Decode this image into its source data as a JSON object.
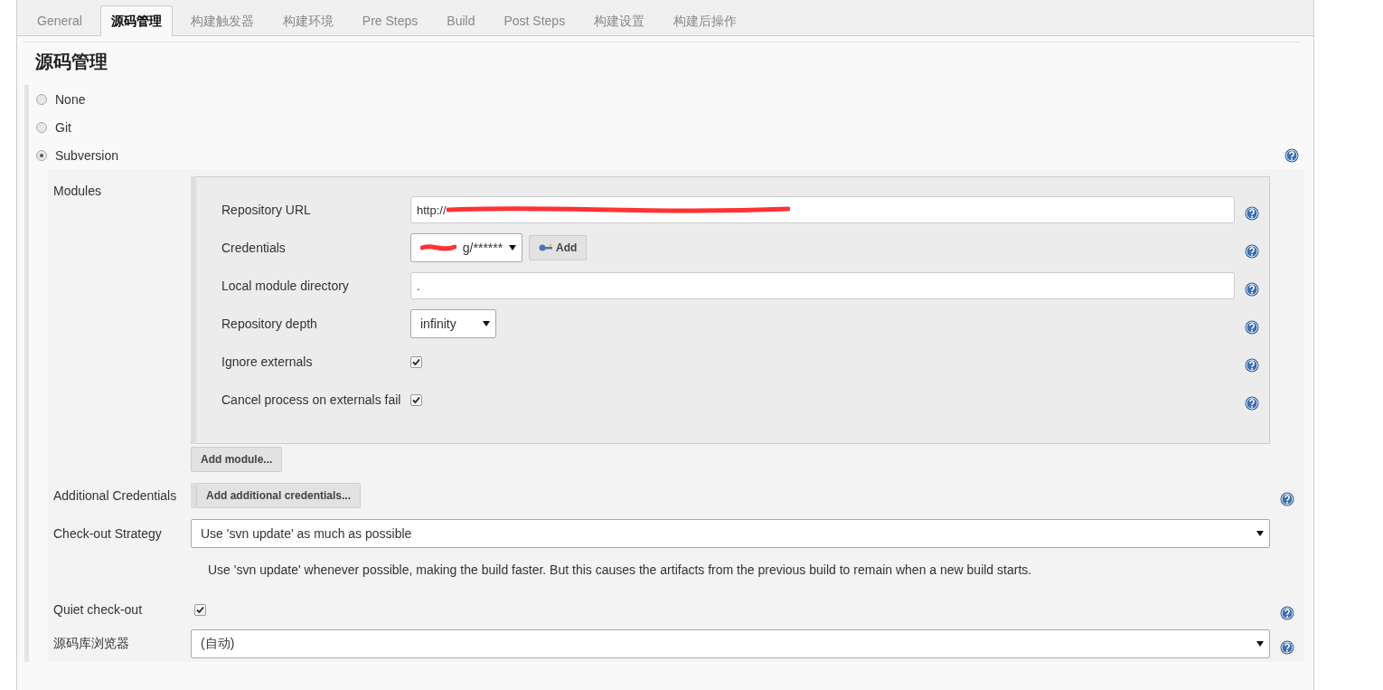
{
  "tabs": [
    {
      "label": "General",
      "selected": false
    },
    {
      "label": "源码管理",
      "selected": true
    },
    {
      "label": "构建触发器",
      "selected": false
    },
    {
      "label": "构建环境",
      "selected": false
    },
    {
      "label": "Pre Steps",
      "selected": false
    },
    {
      "label": "Build",
      "selected": false
    },
    {
      "label": "Post Steps",
      "selected": false
    },
    {
      "label": "构建设置",
      "selected": false
    },
    {
      "label": "构建后操作",
      "selected": false
    }
  ],
  "title": "源码管理",
  "scm_options": [
    {
      "label": "None",
      "selected": false
    },
    {
      "label": "Git",
      "selected": false
    },
    {
      "label": "Subversion",
      "selected": true
    }
  ],
  "modules": {
    "label": "Modules",
    "fields": [
      {
        "kind": "text",
        "label": "Repository URL",
        "value": "http://",
        "redacted": true
      },
      {
        "kind": "credentials",
        "label": "Credentials",
        "value": "g/******",
        "redacted": true,
        "button": "Add"
      },
      {
        "kind": "text",
        "label": "Local module directory",
        "value": "."
      },
      {
        "kind": "select",
        "label": "Repository depth",
        "value": "infinity"
      },
      {
        "kind": "checkbox",
        "label": "Ignore externals",
        "checked": true
      },
      {
        "kind": "checkbox",
        "label": "Cancel process on externals fail",
        "checked": true
      }
    ],
    "add_button": "Add module..."
  },
  "additional_credentials": {
    "label": "Additional Credentials",
    "button": "Add additional credentials..."
  },
  "checkout_strategy": {
    "label": "Check-out Strategy",
    "value": "Use 'svn update' as much as possible",
    "description": "Use 'svn update' whenever possible, making the build faster. But this causes the artifacts from the previous build to remain when a new build starts."
  },
  "quiet_checkout": {
    "label": "Quiet check-out",
    "checked": true
  },
  "repo_browser": {
    "label": "源码库浏览器",
    "value": "(自动)"
  }
}
